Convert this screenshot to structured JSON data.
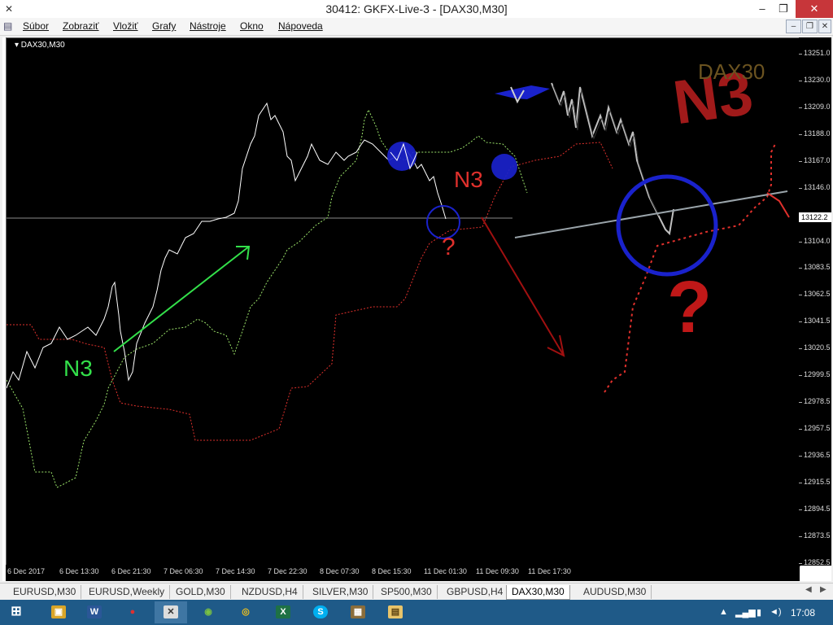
{
  "window": {
    "title": "30412: GKFX-Live-3 - [DAX30,M30]",
    "minimize": "–",
    "restore": "❐",
    "close": "✕"
  },
  "menu": {
    "items": [
      "Súbor",
      "Zobraziť",
      "Vložiť",
      "Grafy",
      "Nástroje",
      "Okno",
      "Nápoveda"
    ]
  },
  "chart": {
    "symbol_label": "▾ DAX30,M30",
    "current_price": "13122.2",
    "y_ticks": [
      "13251.0",
      "13230.0",
      "13209.0",
      "13188.0",
      "13167.0",
      "13146.0",
      "13104.0",
      "13083.5",
      "13062.5",
      "13041.5",
      "13020.5",
      "12999.5",
      "12978.5",
      "12957.5",
      "12936.5",
      "12915.5",
      "12894.5",
      "12873.5",
      "12852.5"
    ],
    "x_ticks": [
      "6 Dec 2017",
      "6 Dec 13:30",
      "6 Dec 21:30",
      "7 Dec 06:30",
      "7 Dec 14:30",
      "7 Dec 22:30",
      "8 Dec 07:30",
      "8 Dec 15:30",
      "11 Dec 01:30",
      "11 Dec 09:30",
      "11 Dec 17:30"
    ],
    "annotations": {
      "n3_green": "N3",
      "n3_red_small": "N3",
      "n3_red_large": "N3",
      "question_small": "?",
      "question_large": "?",
      "watermark": "DAX30"
    },
    "colors": {
      "background": "#000000",
      "price_line": "#ffffff",
      "span_green": "#9be36a",
      "span_red": "#e0302c",
      "arrow_green": "#33e04a",
      "arrow_red": "#a01010",
      "circle_blue": "#1a22cc",
      "trendline": "#9aa4aa"
    }
  },
  "tabs": {
    "items": [
      "EURUSD,M30",
      "EURUSD,Weekly",
      "GOLD,M30",
      "NZDUSD,H4",
      "SILVER,M30",
      "SP500,M30",
      "GBPUSD,H4",
      "DAX30,M30",
      "AUDUSD,M30"
    ],
    "active": "DAX30,M30"
  },
  "taskbar": {
    "apps": [
      {
        "name": "start-button",
        "glyph": "⊞"
      },
      {
        "name": "file-explorer-app",
        "glyph": "▣"
      },
      {
        "name": "word-app",
        "glyph": "W"
      },
      {
        "name": "paint-app",
        "glyph": "●"
      },
      {
        "name": "metatrader-app",
        "glyph": "✕"
      },
      {
        "name": "globe-app",
        "glyph": "◉"
      },
      {
        "name": "chrome-app",
        "glyph": "◎"
      },
      {
        "name": "excel-app",
        "glyph": "X"
      },
      {
        "name": "skype-app",
        "glyph": "S"
      },
      {
        "name": "gallery-app",
        "glyph": "▦"
      },
      {
        "name": "folder-app",
        "glyph": "▤"
      }
    ],
    "clock": "17:08"
  }
}
